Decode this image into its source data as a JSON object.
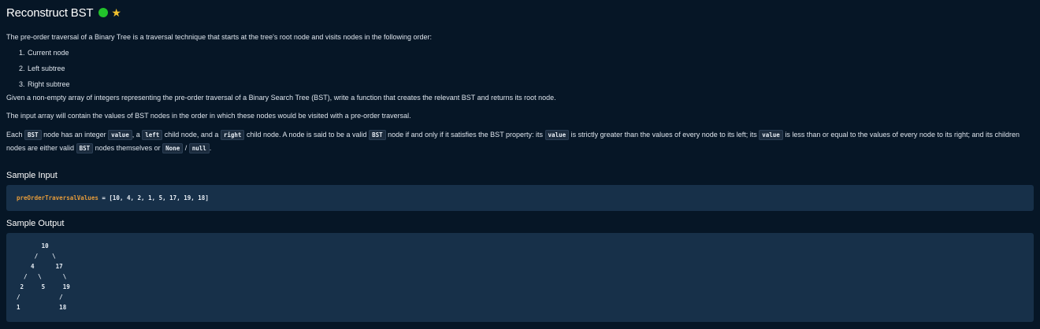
{
  "problem": {
    "title": "Reconstruct BST",
    "status_icon": "green-status-dot",
    "star_icon": "star-icon",
    "intro": "The pre-order traversal of a Binary Tree is a traversal technique that starts at the tree's root node and visits nodes in the following order:",
    "order_list": [
      "Current node",
      "Left subtree",
      "Right subtree"
    ],
    "task": "Given a non-empty array of integers representing the pre-order traversal of a Binary Search Tree (BST), write a function that creates the relevant BST and returns its root node.",
    "input_note": "The input array will contain the values of BST nodes in the order in which these nodes would be visited with a pre-order traversal.",
    "bst_def": {
      "t1": "Each ",
      "c1": "BST",
      "t2": " node has an integer ",
      "c2": "value",
      "t3": ", a ",
      "c3": "left",
      "t4": " child node, and a ",
      "c4": "right",
      "t5": " child node. A node is said to be a valid ",
      "c5": "BST",
      "t6": " node if and only if it satisfies the BST property: its ",
      "c6": "value",
      "t7": " is strictly greater than the values of every node to its left; its ",
      "c7": "value",
      "t8": " is less than or equal to the values of every node to its right; and its children nodes are either valid ",
      "c8": "BST",
      "t9": " nodes themselves or ",
      "c9": "None",
      "t10": " / ",
      "c10": "null",
      "t11": "."
    }
  },
  "sample_input": {
    "heading": "Sample Input",
    "var_name": "preOrderTraversalValues",
    "rest": " = [10, 4, 2, 1, 5, 17, 19, 18]"
  },
  "sample_output": {
    "heading": "Sample Output",
    "tree": "       10\n     /    \\\n    4      17\n  /   \\      \\\n 2     5     19\n/           /\n1           18"
  },
  "colors": {
    "background": "#061626",
    "code_box": "#173049",
    "status_green": "#22c32b",
    "star_yellow": "#f2c12e",
    "variable_orange": "#e59b3a"
  }
}
